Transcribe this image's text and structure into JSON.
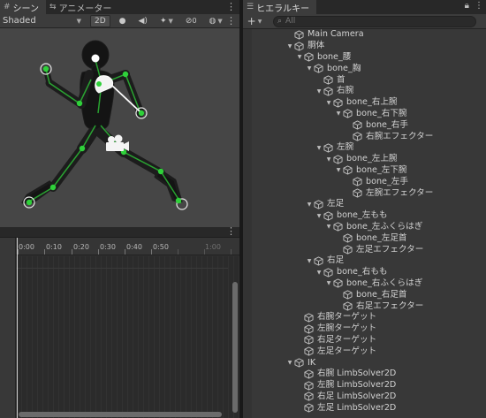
{
  "scene_tabs": [
    {
      "label": "シーン",
      "icon": "hash-icon"
    },
    {
      "label": "アニメーター",
      "icon": "animator-icon"
    }
  ],
  "scene_toolbar": {
    "shading_mode": "Shaded",
    "mode_2d": "2D"
  },
  "animation": {
    "ruler_labels": [
      "0:00",
      "0:10",
      "0:20",
      "0:30",
      "0:40",
      "0:50",
      "1:00"
    ]
  },
  "hierarchy": {
    "tab_label": "ヒエラルキー",
    "add_label": "+",
    "search_placeholder": "All",
    "items": [
      {
        "label": "Main Camera",
        "depth": 0,
        "expanded": null
      },
      {
        "label": "胴体",
        "depth": 0,
        "expanded": true
      },
      {
        "label": "bone_腰",
        "depth": 1,
        "expanded": true
      },
      {
        "label": "bone_胸",
        "depth": 2,
        "expanded": true
      },
      {
        "label": "首",
        "depth": 3,
        "expanded": null
      },
      {
        "label": "右腕",
        "depth": 3,
        "expanded": true
      },
      {
        "label": "bone_右上腕",
        "depth": 4,
        "expanded": true
      },
      {
        "label": "bone_右下腕",
        "depth": 5,
        "expanded": true
      },
      {
        "label": "bone_右手",
        "depth": 6,
        "expanded": null
      },
      {
        "label": "右腕エフェクター",
        "depth": 6,
        "expanded": null
      },
      {
        "label": "左腕",
        "depth": 3,
        "expanded": true
      },
      {
        "label": "bone_左上腕",
        "depth": 4,
        "expanded": true
      },
      {
        "label": "bone_左下腕",
        "depth": 5,
        "expanded": true
      },
      {
        "label": "bone_左手",
        "depth": 6,
        "expanded": null
      },
      {
        "label": "左腕エフェクター",
        "depth": 6,
        "expanded": null
      },
      {
        "label": "左足",
        "depth": 2,
        "expanded": true
      },
      {
        "label": "bone_左もも",
        "depth": 3,
        "expanded": true
      },
      {
        "label": "bone_左ふくらはぎ",
        "depth": 4,
        "expanded": true
      },
      {
        "label": "bone_左足首",
        "depth": 5,
        "expanded": null
      },
      {
        "label": "左足エフェクター",
        "depth": 5,
        "expanded": null
      },
      {
        "label": "右足",
        "depth": 2,
        "expanded": true
      },
      {
        "label": "bone_右もも",
        "depth": 3,
        "expanded": true
      },
      {
        "label": "bone_右ふくらはぎ",
        "depth": 4,
        "expanded": true
      },
      {
        "label": "bone_右足首",
        "depth": 5,
        "expanded": null
      },
      {
        "label": "右足エフェクター",
        "depth": 5,
        "expanded": null
      },
      {
        "label": "右腕ターゲット",
        "depth": 1,
        "expanded": null
      },
      {
        "label": "左腕ターゲット",
        "depth": 1,
        "expanded": null
      },
      {
        "label": "右足ターゲット",
        "depth": 1,
        "expanded": null
      },
      {
        "label": "左足ターゲット",
        "depth": 1,
        "expanded": null
      },
      {
        "label": "IK",
        "depth": 0,
        "expanded": true
      },
      {
        "label": "右腕 LimbSolver2D",
        "depth": 1,
        "expanded": null
      },
      {
        "label": "左腕 LimbSolver2D",
        "depth": 1,
        "expanded": null
      },
      {
        "label": "右足 LimbSolver2D",
        "depth": 1,
        "expanded": null
      },
      {
        "label": "左足 LimbSolver2D",
        "depth": 1,
        "expanded": null
      }
    ]
  },
  "colors": {
    "bone_green": "#2fd13a",
    "selection_ring": "#ffffff",
    "panel_bg": "#383838",
    "scene_bg": "#464646"
  }
}
